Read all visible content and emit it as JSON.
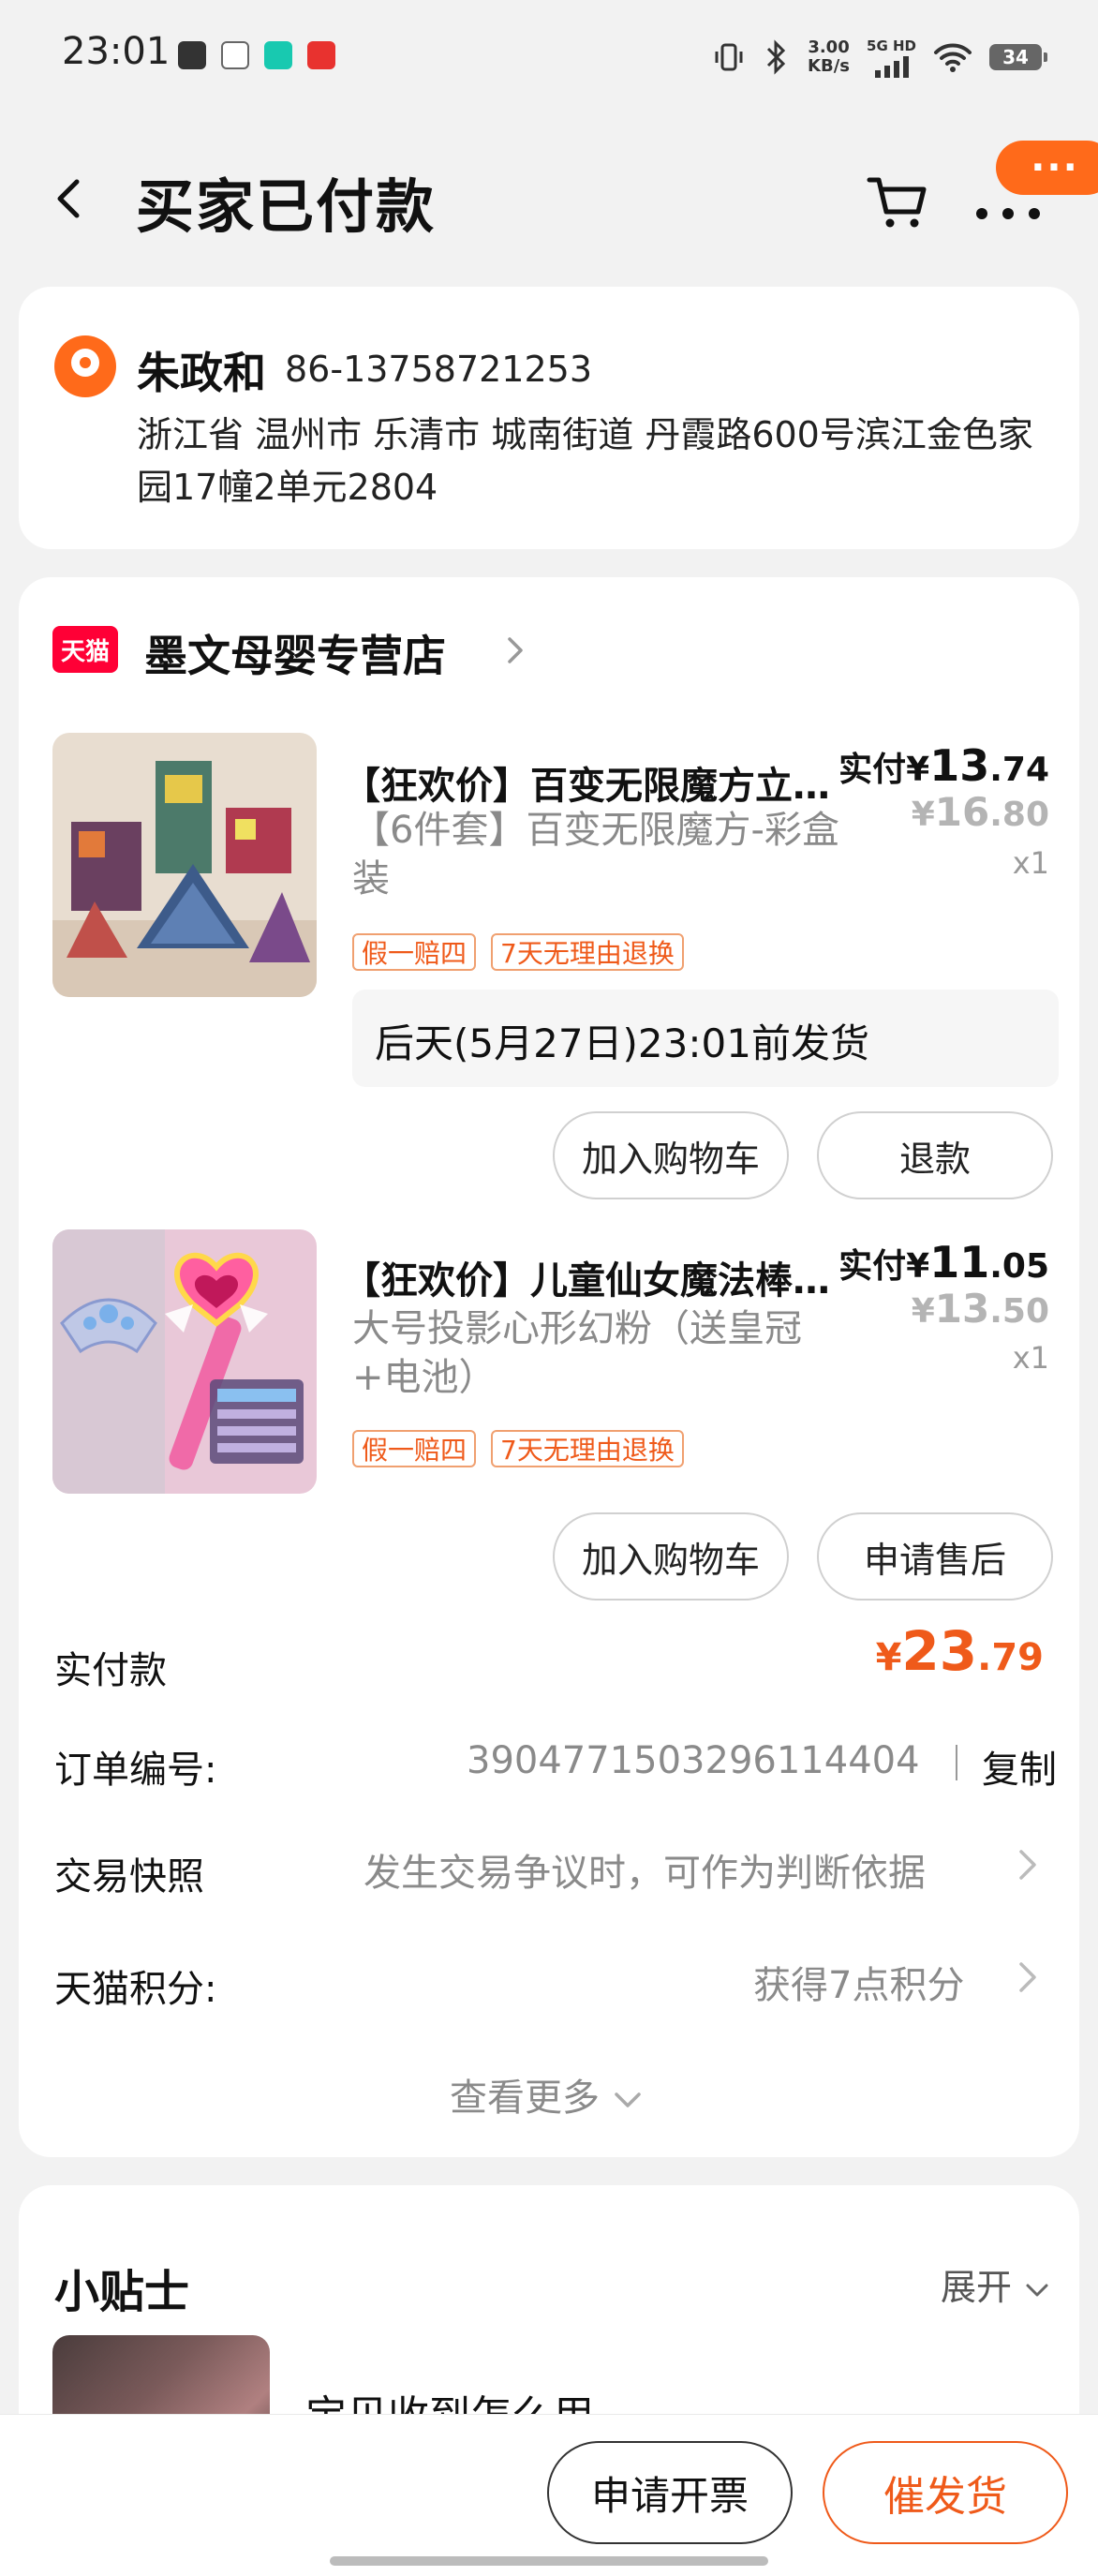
{
  "status_bar": {
    "time": "23:01",
    "net_speed_value": "3.00",
    "net_speed_unit": "KB/s",
    "network": "5G HD",
    "battery": "34",
    "icons": [
      "signal-icon",
      "bluetooth-icon",
      "vibrate-icon",
      "wifi-icon"
    ]
  },
  "header": {
    "title": "买家已付款",
    "more_bubble": "···"
  },
  "address": {
    "name": "朱政和",
    "phone": "86-13758721253",
    "line": "浙江省 温州市 乐清市 城南街道 丹霞路600号滨江金色家园17幢2单元2804"
  },
  "shop": {
    "badge": "天猫",
    "name": "墨文母婴专营店"
  },
  "products": [
    {
      "title": "【狂欢价】百变无限魔方立体几何",
      "spec": "【6件套】百变无限魔方-彩盒装",
      "paid_prefix": "实付",
      "paid_symbol": "¥",
      "paid_int": "13",
      "paid_dec": ".74",
      "orig_symbol": "¥",
      "orig_int": "16",
      "orig_dec": ".80",
      "qty": "x1",
      "tags": [
        "假一赔四",
        "7天无理由退换"
      ],
      "shipping": "后天(5月27日)23:01前发货",
      "actions": [
        "加入购物车",
        "退款"
      ]
    },
    {
      "title": "【狂欢价】儿童仙女魔法棒投影",
      "spec": "大号投影心形幻粉（送皇冠+电池）",
      "paid_prefix": "实付",
      "paid_symbol": "¥",
      "paid_int": "11",
      "paid_dec": ".05",
      "orig_symbol": "¥",
      "orig_int": "13",
      "orig_dec": ".50",
      "qty": "x1",
      "tags": [
        "假一赔四",
        "7天无理由退换"
      ],
      "actions": [
        "加入购物车",
        "申请售后"
      ]
    }
  ],
  "summary": {
    "total_label": "实付款",
    "total_symbol": "¥",
    "total_int": "23",
    "total_dec": ".79",
    "order_no_label": "订单编号:",
    "order_no": "3904771503296114404",
    "copy": "复制",
    "snapshot_label": "交易快照",
    "snapshot_value": "发生交易争议时，可作为判断依据",
    "points_label": "天猫积分:",
    "points_value": "获得7点积分",
    "see_more": "查看更多"
  },
  "tips": {
    "title": "小贴士",
    "expand": "展开",
    "item_title": "宝贝收到怎么用"
  },
  "bottom": {
    "invoice": "申请开票",
    "urge": "催发货"
  },
  "colors": {
    "accent": "#ef5a1a",
    "bubble": "#ff6a1a",
    "tmall": "#ff0036",
    "background": "#f2f2f2"
  }
}
